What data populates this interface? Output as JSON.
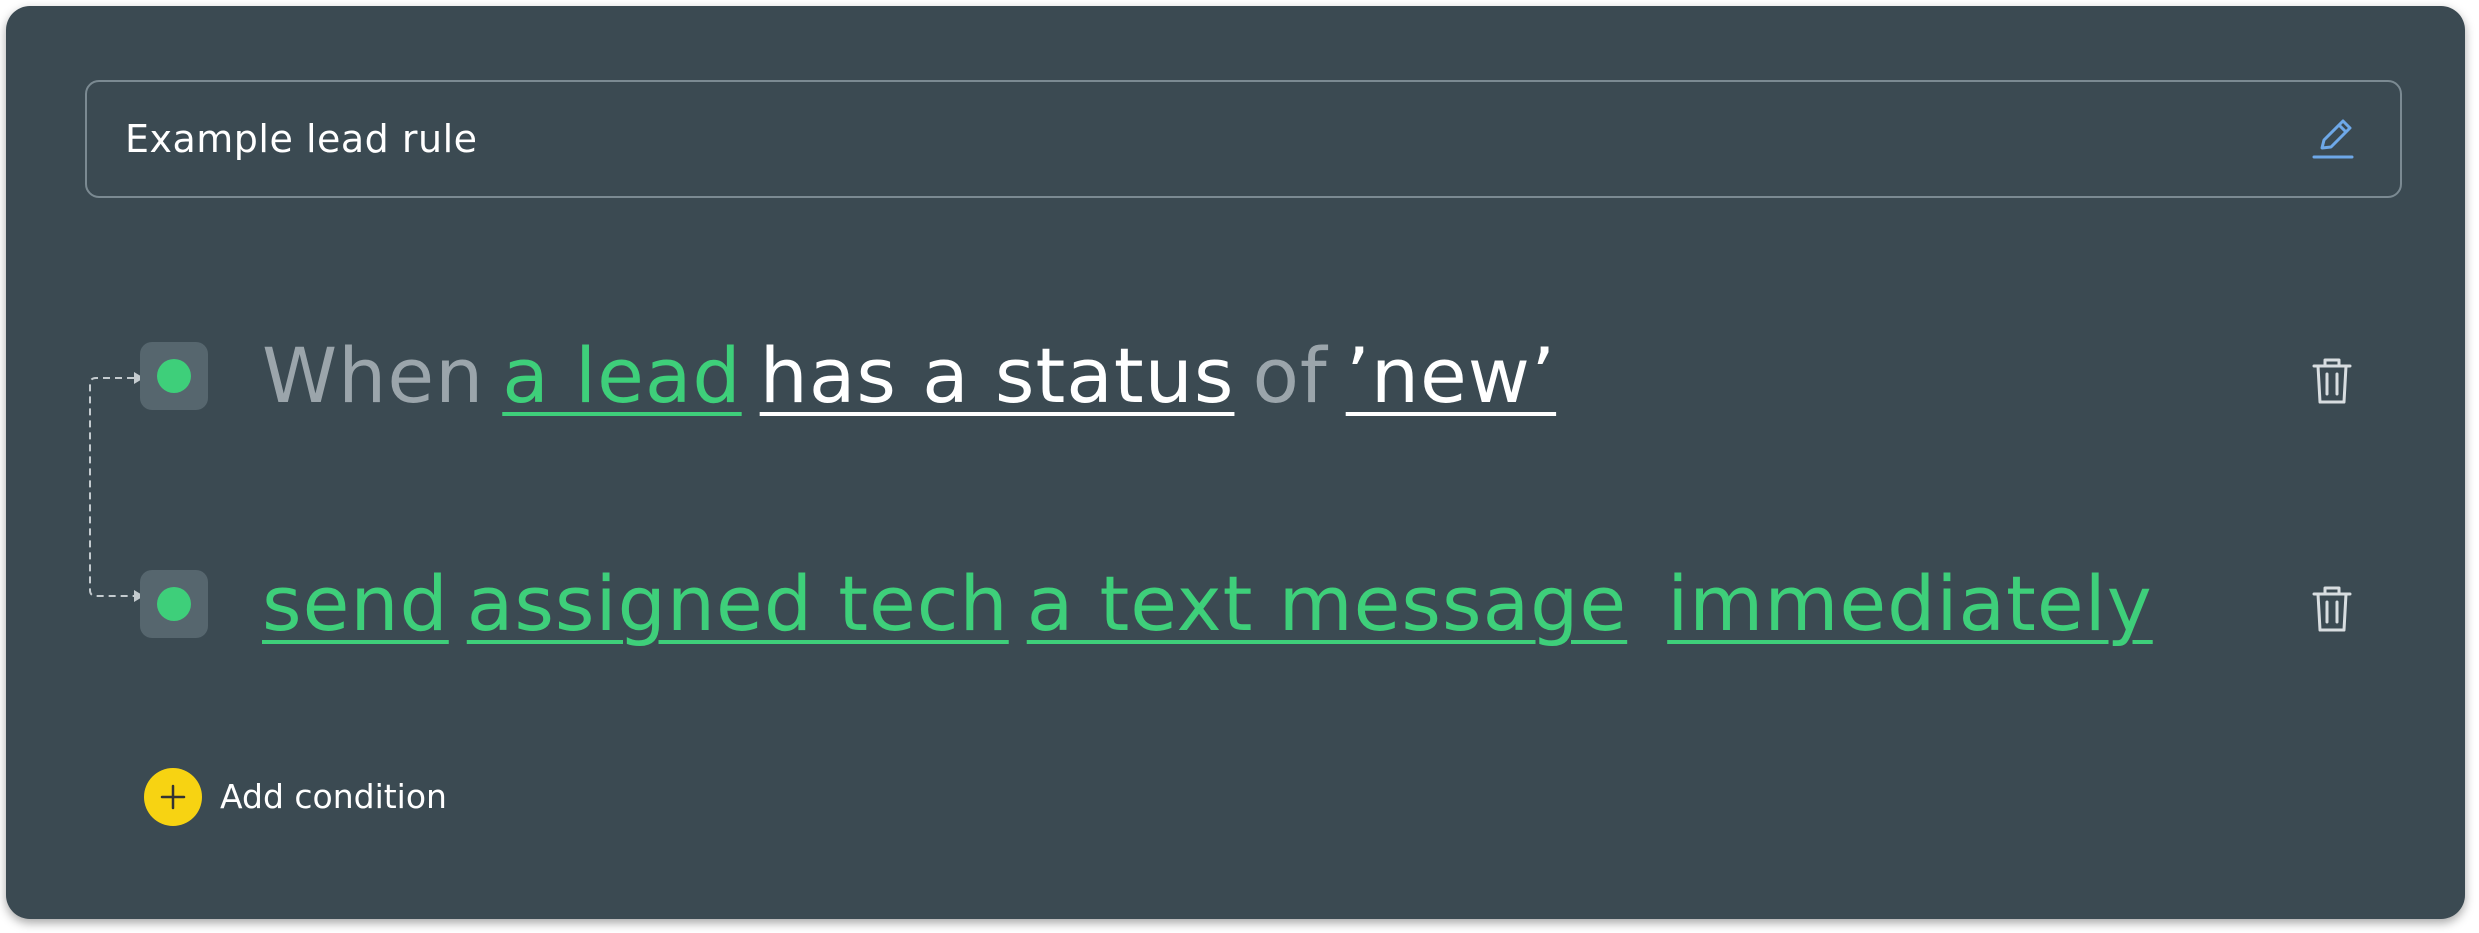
{
  "rule": {
    "title": "Example lead rule"
  },
  "trigger": {
    "when": "When",
    "subject": "a lead",
    "condition": "has a status",
    "of": "of",
    "value": "’new’"
  },
  "action": {
    "verb": "send",
    "recipient": "assigned tech",
    "message": "a text message",
    "timing": "immediately"
  },
  "add_condition": {
    "label": "Add condition"
  },
  "icons": {
    "edit": "pencil-icon",
    "delete": "trash-icon",
    "add": "plus-icon"
  },
  "colors": {
    "card_bg": "#3b4a52",
    "accent_green": "#3ecf7a",
    "accent_yellow": "#f7d312",
    "edit_icon_blue": "#6ea8e8",
    "muted_text": "#9ba5ab"
  }
}
